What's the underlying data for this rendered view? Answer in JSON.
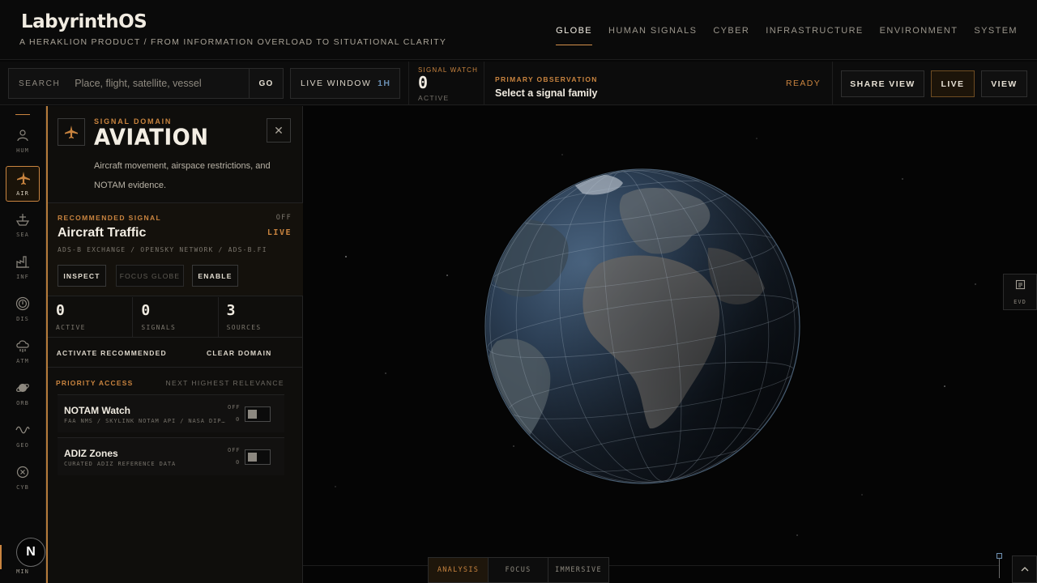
{
  "app": {
    "title": "LabyrinthOS",
    "tagline": "A HERAKLION PRODUCT / FROM INFORMATION OVERLOAD TO SITUATIONAL CLARITY"
  },
  "nav": {
    "tabs": [
      {
        "label": "GLOBE",
        "active": true
      },
      {
        "label": "HUMAN SIGNALS",
        "active": false
      },
      {
        "label": "CYBER",
        "active": false
      },
      {
        "label": "INFRASTRUCTURE",
        "active": false
      },
      {
        "label": "ENVIRONMENT",
        "active": false
      },
      {
        "label": "SYSTEM",
        "active": false
      }
    ]
  },
  "toolbar": {
    "search_label": "SEARCH",
    "search_placeholder": "Place, flight, satellite, vessel",
    "search_value": "",
    "go_label": "GO",
    "live_window_label": "LIVE WINDOW",
    "live_window_value": "1H",
    "signal_watch_label": "SIGNAL WATCH",
    "signal_watch_value": "0",
    "signal_watch_sub": "ACTIVE",
    "primary_observation_label": "PRIMARY OBSERVATION",
    "primary_observation_value": "Select a signal family",
    "status": "READY",
    "share_view_label": "SHARE VIEW",
    "live_label": "LIVE",
    "view_label": "VIEW"
  },
  "rail": {
    "items": [
      {
        "label": "HUM",
        "icon": "person-icon",
        "active": false
      },
      {
        "label": "AIR",
        "icon": "airplane-icon",
        "active": true
      },
      {
        "label": "SEA",
        "icon": "ship-icon",
        "active": false
      },
      {
        "label": "INF",
        "icon": "factory-icon",
        "active": false
      },
      {
        "label": "DIS",
        "icon": "alert-circle-icon",
        "active": false
      },
      {
        "label": "ATM",
        "icon": "cloud-rain-icon",
        "active": false
      },
      {
        "label": "ORB",
        "icon": "orbit-icon",
        "active": false
      },
      {
        "label": "GEO",
        "icon": "wave-icon",
        "active": false
      },
      {
        "label": "CYB",
        "icon": "cyber-icon",
        "active": false
      }
    ],
    "min_label": "MIN",
    "avatar_letter": "N"
  },
  "domain": {
    "kicker": "SIGNAL DOMAIN",
    "title": "AVIATION",
    "description": "Aircraft movement, airspace restrictions, and NOTAM evidence.",
    "close_icon": "close-icon",
    "recommended": {
      "kicker": "RECOMMENDED SIGNAL",
      "state": "OFF",
      "title": "Aircraft Traffic",
      "badge": "LIVE",
      "sources": "ADS-B EXCHANGE / OPENSKY NETWORK / ADS-B.FI",
      "inspect_label": "INSPECT",
      "focus_globe_label": "FOCUS GLOBE",
      "enable_label": "ENABLE"
    },
    "stats": [
      {
        "value": "0",
        "label": "ACTIVE"
      },
      {
        "value": "0",
        "label": "SIGNALS"
      },
      {
        "value": "3",
        "label": "SOURCES"
      }
    ],
    "activate_recommended_label": "ACTIVATE RECOMMENDED",
    "clear_domain_label": "CLEAR DOMAIN",
    "priority": {
      "title": "PRIORITY ACCESS",
      "subtitle": "NEXT HIGHEST RELEVANCE",
      "items": [
        {
          "name": "NOTAM Watch",
          "sources": "FAA NMS / SKYLINK NOTAM API / NASA DIP …",
          "state": "OFF",
          "count": "0"
        },
        {
          "name": "ADIZ Zones",
          "sources": "CURATED ADIZ REFERENCE DATA",
          "state": "OFF",
          "count": "0"
        }
      ]
    }
  },
  "evidence": {
    "label": "EVD"
  },
  "modes": {
    "tabs": [
      {
        "label": "ANALYSIS",
        "active": true
      },
      {
        "label": "FOCUS",
        "active": false
      },
      {
        "label": "IMMERSIVE",
        "active": false
      }
    ]
  },
  "colors": {
    "accent": "#c9843f",
    "background": "#070707",
    "panel": "#0f0e0c",
    "text": "#f0ebe1",
    "live_window_value": "#6a8fb3"
  }
}
